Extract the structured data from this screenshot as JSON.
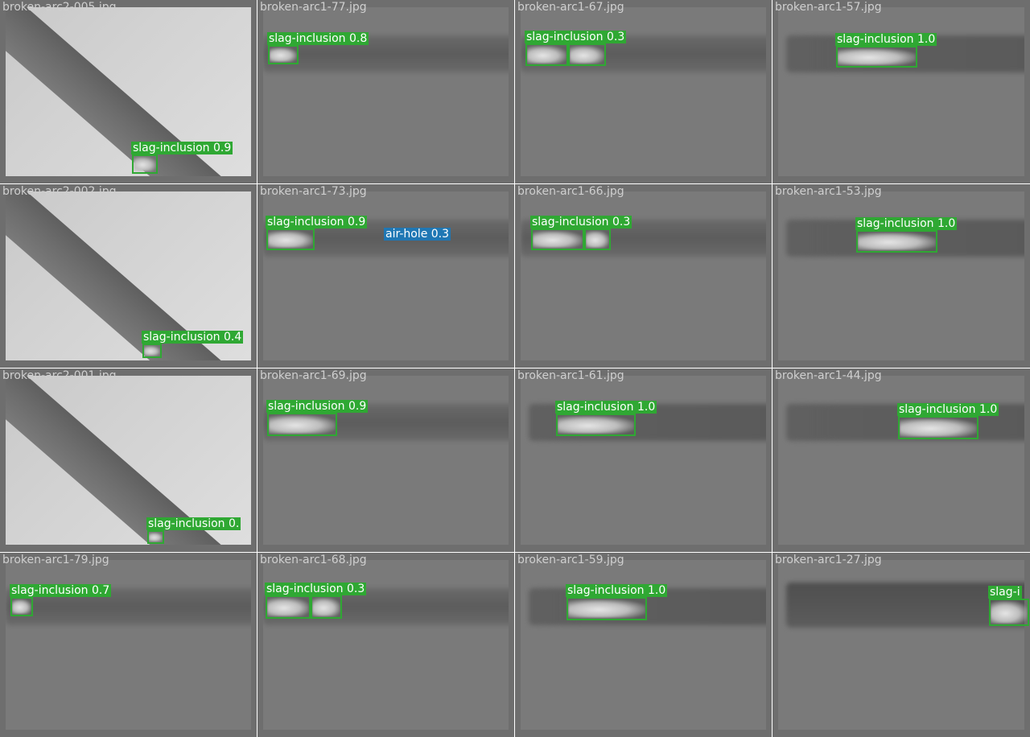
{
  "colors": {
    "slag-inclusion": "#2fa833",
    "air-hole": "#1f77b4"
  },
  "tiles": [
    {
      "file": "broken-arc2-005.jpg",
      "scene": "diagonal",
      "detections": [
        {
          "label": "slag-inclusion 0.9",
          "cls": "slag-inclusion"
        }
      ]
    },
    {
      "file": "broken-arc1-77.jpg",
      "scene": "band-left",
      "detections": [
        {
          "label": "slag-inclusion 0.8",
          "cls": "slag-inclusion"
        }
      ]
    },
    {
      "file": "broken-arc1-67.jpg",
      "scene": "band-left",
      "detections": [
        {
          "label": "slag-inclusion 0.3",
          "cls": "slag-inclusion"
        },
        {
          "label": "",
          "cls": "slag-inclusion"
        }
      ]
    },
    {
      "file": "broken-arc1-57.jpg",
      "scene": "band-mid",
      "detections": [
        {
          "label": "slag-inclusion 1.0",
          "cls": "slag-inclusion"
        }
      ]
    },
    {
      "file": "broken-arc2-002.jpg",
      "scene": "diagonal",
      "detections": [
        {
          "label": "slag-inclusion 0.4",
          "cls": "slag-inclusion"
        }
      ]
    },
    {
      "file": "broken-arc1-73.jpg",
      "scene": "band-left",
      "detections": [
        {
          "label": "slag-inclusion 0.9",
          "cls": "slag-inclusion"
        },
        {
          "label": "air-hole 0.3",
          "cls": "air-hole"
        }
      ]
    },
    {
      "file": "broken-arc1-66.jpg",
      "scene": "band-left",
      "detections": [
        {
          "label": "slag-inclusion 0.3",
          "cls": "slag-inclusion"
        },
        {
          "label": "",
          "cls": "slag-inclusion"
        }
      ]
    },
    {
      "file": "broken-arc1-53.jpg",
      "scene": "band-mid",
      "detections": [
        {
          "label": "slag-inclusion 1.0",
          "cls": "slag-inclusion"
        }
      ]
    },
    {
      "file": "broken-arc2-001.jpg",
      "scene": "diagonal",
      "detections": [
        {
          "label": "slag-inclusion 0.",
          "cls": "slag-inclusion"
        }
      ]
    },
    {
      "file": "broken-arc1-69.jpg",
      "scene": "band-left",
      "detections": [
        {
          "label": "slag-inclusion 0.9",
          "cls": "slag-inclusion"
        }
      ]
    },
    {
      "file": "broken-arc1-61.jpg",
      "scene": "band-mid",
      "detections": [
        {
          "label": "slag-inclusion 1.0",
          "cls": "slag-inclusion"
        }
      ]
    },
    {
      "file": "broken-arc1-44.jpg",
      "scene": "band-mid",
      "detections": [
        {
          "label": "slag-inclusion 1.0",
          "cls": "slag-inclusion"
        }
      ]
    },
    {
      "file": "broken-arc1-79.jpg",
      "scene": "band-left",
      "detections": [
        {
          "label": "slag-inclusion 0.7",
          "cls": "slag-inclusion"
        }
      ]
    },
    {
      "file": "broken-arc1-68.jpg",
      "scene": "band-left",
      "detections": [
        {
          "label": "slag-inclusion 0.3",
          "cls": "slag-inclusion"
        },
        {
          "label": "",
          "cls": "slag-inclusion"
        }
      ]
    },
    {
      "file": "broken-arc1-59.jpg",
      "scene": "band-mid",
      "detections": [
        {
          "label": "slag-inclusion 1.0",
          "cls": "slag-inclusion"
        }
      ]
    },
    {
      "file": "broken-arc1-27.jpg",
      "scene": "band-right",
      "detections": [
        {
          "label": "slag-i",
          "cls": "slag-inclusion"
        }
      ]
    }
  ]
}
